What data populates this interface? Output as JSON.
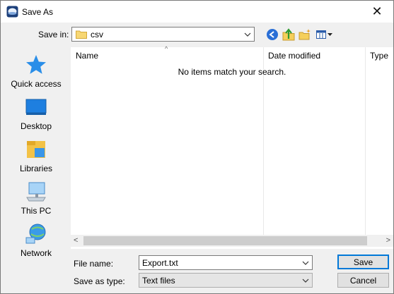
{
  "window": {
    "title": "Save As",
    "accent": "#0078d7"
  },
  "toolbar": {
    "save_in_label": "Save in:",
    "save_in_value": "csv",
    "icons": [
      "back-icon",
      "up-folder-icon",
      "new-folder-icon",
      "view-menu-icon"
    ]
  },
  "places": [
    {
      "label": "Quick access",
      "icon": "quick-access-star-icon"
    },
    {
      "label": "Desktop",
      "icon": "desktop-icon"
    },
    {
      "label": "Libraries",
      "icon": "libraries-icon"
    },
    {
      "label": "This PC",
      "icon": "this-pc-icon"
    },
    {
      "label": "Network",
      "icon": "network-icon"
    }
  ],
  "file_list": {
    "columns": [
      "Name",
      "Date modified",
      "Type"
    ],
    "empty_message": "No items match your search."
  },
  "form": {
    "file_name_label": "File name:",
    "file_name_value": "Export.txt",
    "save_as_type_label": "Save as type:",
    "save_as_type_value": "Text files"
  },
  "buttons": {
    "save": "Save",
    "cancel": "Cancel"
  }
}
